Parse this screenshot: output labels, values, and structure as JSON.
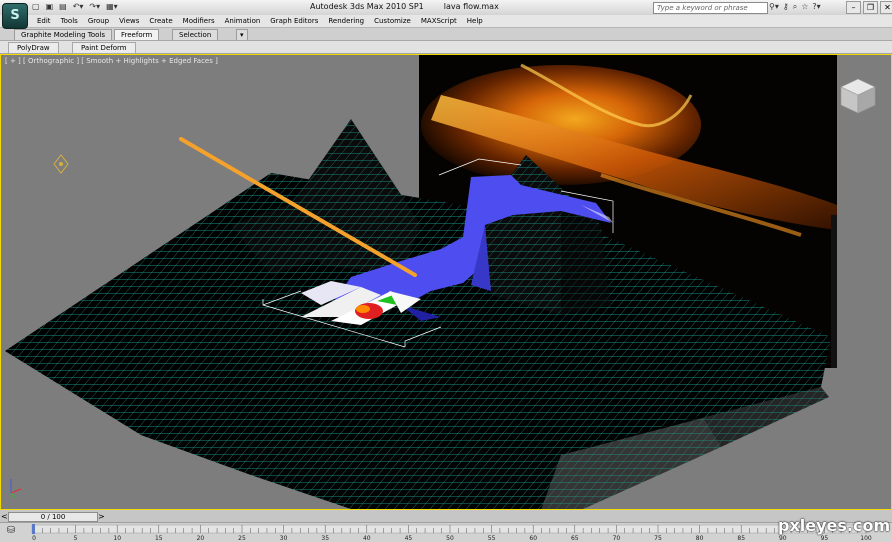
{
  "window": {
    "app_title": "Autodesk 3ds Max  2010 SP1",
    "file_name": "lava flow.max",
    "logo": "3ds-max-logo",
    "search_placeholder": "Type a keyword or phrase",
    "quick_access": [
      "new-icon",
      "open-icon",
      "save-icon",
      "undo-icon",
      "redo-icon",
      "project-icon"
    ],
    "toolbar_icons": [
      "binoculars-icon",
      "key-icon",
      "search-icon",
      "star-icon",
      "help-icon"
    ],
    "window_buttons": [
      "–",
      "❐",
      "✕"
    ]
  },
  "menu": {
    "items": [
      "Edit",
      "Tools",
      "Group",
      "Views",
      "Create",
      "Modifiers",
      "Animation",
      "Graph Editors",
      "Rendering",
      "Customize",
      "MAXScript",
      "Help"
    ]
  },
  "ribbon": {
    "tabs": [
      "Graphite Modeling Tools",
      "Freeform",
      "Selection"
    ],
    "active_tab": "Freeform",
    "panel_tabs": [
      "PolyDraw",
      "Paint Deform"
    ]
  },
  "viewport": {
    "label": "[ + ] [ Orthographic ] [ Smooth + Highlights + Edged Faces ]",
    "wire_color": "#20b0a0",
    "lava_color": "#4d4df0",
    "beam_color": "#f4a22c",
    "border_color": "#f2d900"
  },
  "timeline": {
    "frame_display": "0 / 100",
    "ticks": [
      0,
      5,
      10,
      15,
      20,
      25,
      30,
      35,
      40,
      45,
      50,
      55,
      60,
      65,
      70,
      75,
      80,
      85,
      90,
      95,
      100
    ]
  },
  "watermark": "pxleyes.com"
}
